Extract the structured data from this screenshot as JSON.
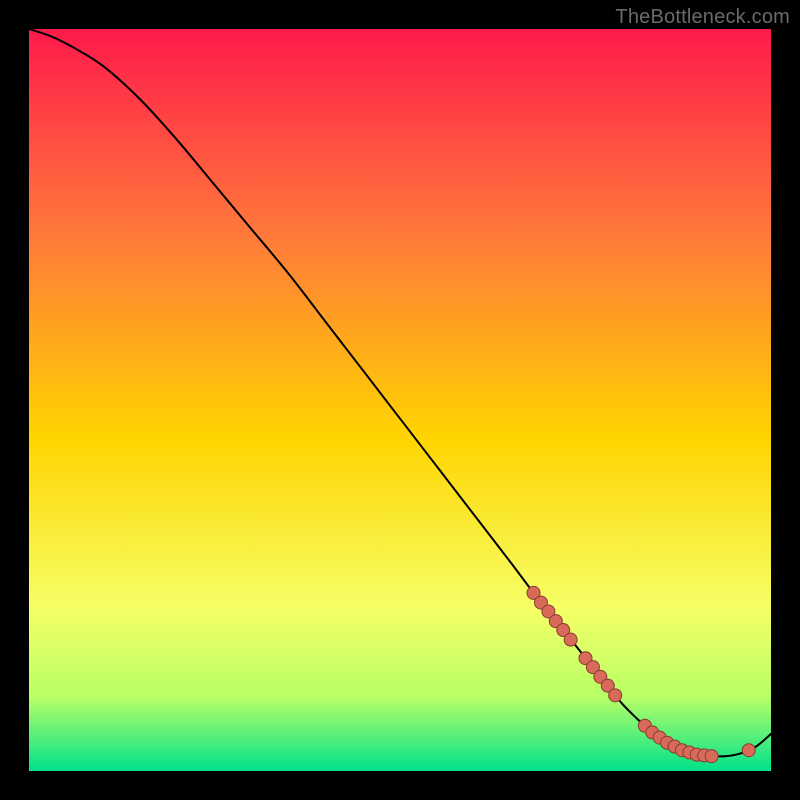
{
  "watermark": "TheBottleneck.com",
  "colors": {
    "page_bg": "#000000",
    "gradient_top": "#ff1a4b",
    "gradient_mid1": "#ff7a3a",
    "gradient_mid2": "#ffd400",
    "gradient_mid3": "#f6ff66",
    "gradient_mid4": "#b8ff66",
    "gradient_bottom": "#00e28a",
    "curve": "#000000",
    "marker_fill": "#d86a5a",
    "marker_stroke": "#8a3a30"
  },
  "chart_data": {
    "type": "line",
    "title": "",
    "xlabel": "",
    "ylabel": "",
    "xlim": [
      0,
      100
    ],
    "ylim": [
      0,
      100
    ],
    "grid": false,
    "legend": false,
    "series": [
      {
        "name": "bottleneck-curve",
        "x": [
          0,
          3,
          6,
          10,
          15,
          20,
          25,
          30,
          35,
          40,
          45,
          50,
          55,
          60,
          65,
          68,
          70,
          72,
          74,
          76,
          78,
          80,
          82,
          84,
          86,
          88,
          90,
          92,
          94,
          96,
          98,
          100
        ],
        "y": [
          100,
          99,
          97.5,
          95,
          90.5,
          85,
          79,
          73,
          67,
          60.5,
          54,
          47.5,
          41,
          34.5,
          28,
          24,
          21.5,
          19,
          16.5,
          14,
          11.5,
          9,
          7,
          5.2,
          3.8,
          2.8,
          2.2,
          2.0,
          2.0,
          2.4,
          3.3,
          5
        ]
      }
    ],
    "markers": {
      "name": "highlighted-points",
      "points": [
        {
          "x": 68,
          "y": 24
        },
        {
          "x": 69,
          "y": 22.7
        },
        {
          "x": 70,
          "y": 21.5
        },
        {
          "x": 71,
          "y": 20.2
        },
        {
          "x": 72,
          "y": 19
        },
        {
          "x": 73,
          "y": 17.7
        },
        {
          "x": 75,
          "y": 15.2
        },
        {
          "x": 76,
          "y": 14
        },
        {
          "x": 77,
          "y": 12.7
        },
        {
          "x": 78,
          "y": 11.5
        },
        {
          "x": 79,
          "y": 10.2
        },
        {
          "x": 83,
          "y": 6.1
        },
        {
          "x": 84,
          "y": 5.2
        },
        {
          "x": 85,
          "y": 4.5
        },
        {
          "x": 86,
          "y": 3.8
        },
        {
          "x": 87,
          "y": 3.3
        },
        {
          "x": 88,
          "y": 2.8
        },
        {
          "x": 89,
          "y": 2.5
        },
        {
          "x": 90,
          "y": 2.2
        },
        {
          "x": 91,
          "y": 2.1
        },
        {
          "x": 92,
          "y": 2.0
        },
        {
          "x": 97,
          "y": 2.8
        }
      ]
    }
  }
}
